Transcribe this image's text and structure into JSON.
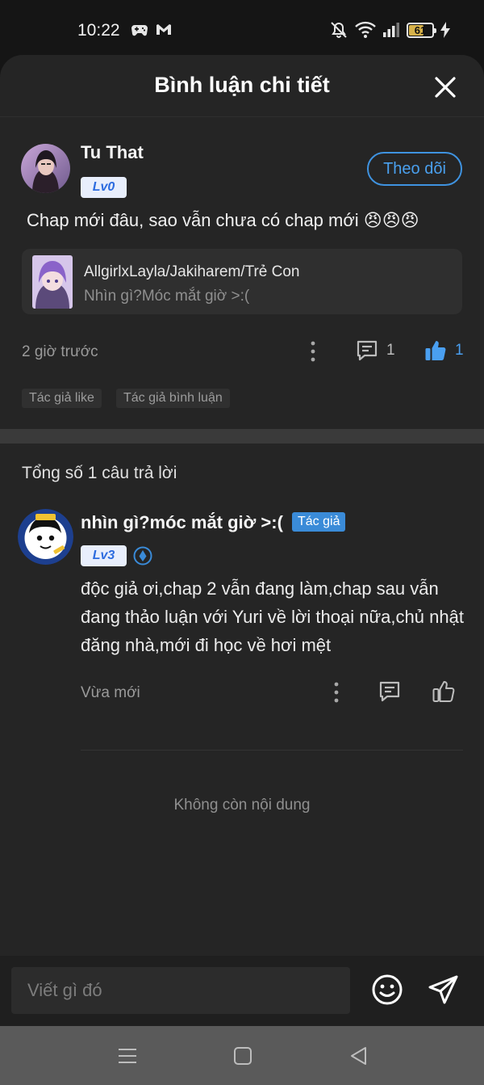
{
  "status": {
    "time": "10:22",
    "battery": "61",
    "left_icons": [
      "gamepad-icon",
      "gmail-icon"
    ],
    "right_icons": [
      "mute-icon",
      "wifi-icon",
      "signal-icon",
      "battery-icon",
      "charging-icon"
    ]
  },
  "header": {
    "title": "Bình luận chi tiết"
  },
  "comment": {
    "user": "Tu That",
    "level": "Lv0",
    "follow_label": "Theo dõi",
    "text": "Chap mới đâu, sao vẫn chưa có chap mới 😠😠😠",
    "ref_title": "AllgirlxLayla/Jakiharem/Trẻ Con",
    "ref_subtitle": "Nhìn gì?Móc mắt giờ >:(",
    "time": "2 giờ trước",
    "reply_count": "1",
    "like_count": "1",
    "tags": [
      "Tác giả like",
      "Tác giả bình luận"
    ]
  },
  "replies": {
    "count_label": "Tổng số 1 câu trả lời",
    "items": [
      {
        "user": "nhìn gì?móc mắt giờ >:(",
        "author_tag": "Tác giả",
        "level": "Lv3",
        "text": "độc giả ơi,chap 2 vẫn đang làm,chap sau vẫn đang thảo luận với Yuri về lời thoại nữa,chủ nhật đăng nhà,mới đi học về hơi mệt",
        "time": "Vừa mới"
      }
    ],
    "end_label": "Không còn nội dung"
  },
  "input": {
    "placeholder": "Viết gì đó"
  },
  "colors": {
    "accent": "#3f93e0",
    "background": "#252525",
    "like_active": "#4a9ff0"
  }
}
